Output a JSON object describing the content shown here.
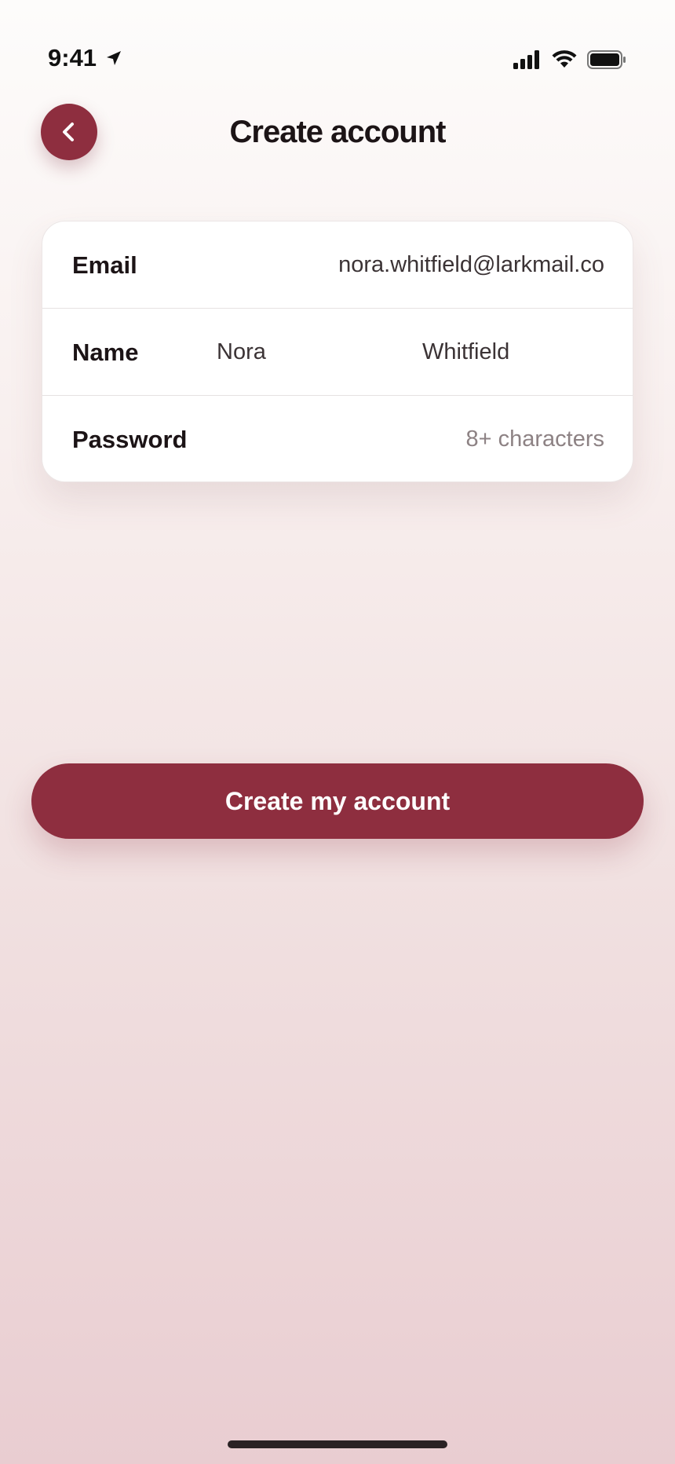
{
  "status_bar": {
    "time": "9:41",
    "icons": [
      "location-arrow-icon",
      "cellular-signal-icon",
      "wifi-icon",
      "battery-icon"
    ]
  },
  "header": {
    "title": "Create account",
    "back_icon": "chevron-left-icon"
  },
  "form": {
    "email": {
      "label": "Email",
      "value": "nora.whitfield@larkmail.co"
    },
    "name": {
      "label": "Name",
      "first": "Nora",
      "last": "Whitfield"
    },
    "password": {
      "label": "Password",
      "placeholder": "8+ characters"
    }
  },
  "primary_button": {
    "label": "Create my account"
  },
  "colors": {
    "accent": "#8e2e3f",
    "text": "#1c1416",
    "placeholder": "#8d8284"
  }
}
